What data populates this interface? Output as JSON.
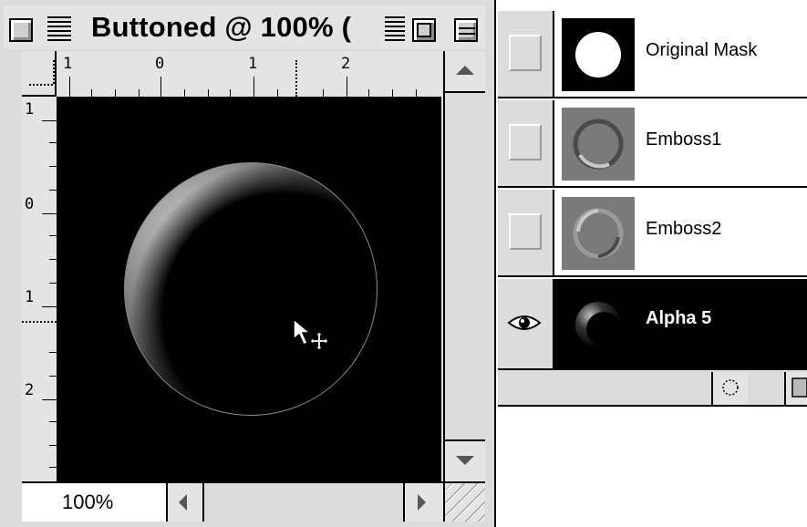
{
  "document_window": {
    "title": "Buttoned @ 100% (",
    "zoom_level": "100%",
    "ruler": {
      "horizontal_labels": [
        "1",
        "0",
        "1",
        "2"
      ],
      "vertical_labels": [
        "1",
        "0",
        "1",
        "2"
      ]
    }
  },
  "channels_palette": {
    "channels": [
      {
        "name": "Original Mask",
        "visible": false,
        "selected": false,
        "thumbnail": "white-circle-mask"
      },
      {
        "name": "Emboss1",
        "visible": false,
        "selected": false,
        "thumbnail": "embossed-ring"
      },
      {
        "name": "Emboss2",
        "visible": false,
        "selected": false,
        "thumbnail": "embossed-ring"
      },
      {
        "name": "Alpha 5",
        "visible": true,
        "selected": true,
        "thumbnail": "shaded-sphere"
      }
    ],
    "footer_buttons": [
      "load-selection-icon",
      "save-selection-icon"
    ]
  },
  "colors": {
    "window_gray": "#dcdcdc",
    "selection": "#000000",
    "canvas": "#000000"
  }
}
